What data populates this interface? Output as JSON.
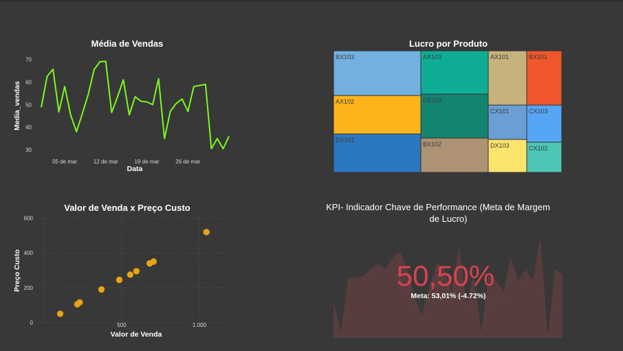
{
  "colors": {
    "background": "#383838",
    "line": "#7cfc1e",
    "scatter": "#e8a317",
    "kpi_value": "#d9434f",
    "kpi_area": "#5a3d3f"
  },
  "chart_data": [
    {
      "type": "line",
      "title": "Média de Vendas",
      "xlabel": "Data",
      "ylabel": "Media_vendas",
      "x_start": "2022-03-01",
      "x_ticks": [
        "05 de mar",
        "12 de mar",
        "19 de mar",
        "26 de mar"
      ],
      "x_tick_dates": [
        "2022-03-05",
        "2022-03-12",
        "2022-03-19",
        "2022-03-26"
      ],
      "y_ticks": [
        30,
        40,
        50,
        60,
        70
      ],
      "ylim": [
        27,
        72
      ],
      "series": [
        {
          "x": [
            "2022-03-01",
            "2022-03-02",
            "2022-03-03",
            "2022-03-04",
            "2022-03-05",
            "2022-03-06",
            "2022-03-07",
            "2022-03-08",
            "2022-03-09",
            "2022-03-10",
            "2022-03-11",
            "2022-03-12",
            "2022-03-13",
            "2022-03-14",
            "2022-03-15",
            "2022-03-16",
            "2022-03-17",
            "2022-03-18",
            "2022-03-19",
            "2022-03-20",
            "2022-03-21",
            "2022-03-22",
            "2022-03-23",
            "2022-03-24",
            "2022-03-25",
            "2022-03-26",
            "2022-03-27",
            "2022-03-28",
            "2022-03-29",
            "2022-03-30",
            "2022-03-31",
            "2022-04-01",
            "2022-04-02"
          ],
          "values": [
            48.8,
            62.5,
            65.7,
            46.8,
            58,
            45.5,
            38,
            46,
            54.5,
            65.5,
            69,
            69.2,
            46.5,
            53.5,
            61,
            45.5,
            53.5,
            51.5,
            51.2,
            50,
            61.5,
            35,
            47,
            50.5,
            52.5,
            47,
            58,
            58.5,
            59,
            30.5,
            35,
            30.5,
            36
          ]
        }
      ],
      "grid": false
    },
    {
      "type": "treemap",
      "title": "Lucro por Produto",
      "items": [
        {
          "label": "BX103",
          "color": "#72b0e0"
        },
        {
          "label": "AX102",
          "color": "#fbb41a"
        },
        {
          "label": "DX101",
          "color": "#2b78be"
        },
        {
          "label": "AX103",
          "color": "#10ad96"
        },
        {
          "label": "DX102",
          "color": "#138470"
        },
        {
          "label": "BX102",
          "color": "#ad9373"
        },
        {
          "label": "AX101",
          "color": "#c6b27d"
        },
        {
          "label": "CX101",
          "color": "#6c9ed6"
        },
        {
          "label": "DX103",
          "color": "#fde46c"
        },
        {
          "label": "BX101",
          "color": "#f0572c"
        },
        {
          "label": "CX103",
          "color": "#56a4f4"
        },
        {
          "label": "CX102",
          "color": "#4dc6b6"
        }
      ]
    },
    {
      "type": "scatter",
      "title": "Valor de Venda x Preço Custo",
      "xlabel": "Valor de Venda",
      "ylabel": "Preço Custo",
      "x_ticks": [
        500,
        1000
      ],
      "x_tick_labels": [
        "500",
        "1.000"
      ],
      "y_ticks": [
        0,
        200,
        400,
        600
      ],
      "xlim": [
        -30,
        1190
      ],
      "ylim": [
        -10,
        630
      ],
      "grid": true,
      "points": [
        {
          "x": 105,
          "y": 50
        },
        {
          "x": 215,
          "y": 105
        },
        {
          "x": 230,
          "y": 115
        },
        {
          "x": 370,
          "y": 190
        },
        {
          "x": 485,
          "y": 245
        },
        {
          "x": 555,
          "y": 275
        },
        {
          "x": 595,
          "y": 295
        },
        {
          "x": 680,
          "y": 340
        },
        {
          "x": 705,
          "y": 350
        },
        {
          "x": 1045,
          "y": 520
        }
      ]
    }
  ],
  "kpi": {
    "title_line1": "KPI- Indicador Chave de Performance (Meta de Margem",
    "title_line2": "de Lucro)",
    "value": "50,50%",
    "goal": "Meta: 53,01% (-4.72%)",
    "trend": [
      0.32,
      0.05,
      0.52,
      0.53,
      0.54,
      0.6,
      0.65,
      0.6,
      0.7,
      0.75,
      0.6,
      0.35,
      0.2,
      0.45,
      0.65,
      0.6,
      0.4,
      0.8,
      0.3,
      0.55,
      0.05,
      0.55,
      0.5,
      0.4,
      0.7,
      0.5,
      0.6,
      0.5,
      0.88,
      0.02,
      0.6,
      0.55
    ]
  }
}
